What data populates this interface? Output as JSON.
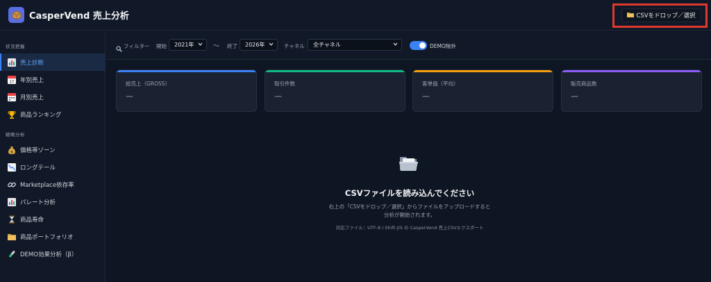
{
  "header": {
    "app_title": "CasperVend 売上分析",
    "csv_button_label": "CSVをドロップ／選択"
  },
  "sidebar": {
    "sections": [
      {
        "label": "状況把握"
      },
      {
        "label": "戦略分析"
      }
    ],
    "items": [
      {
        "label": "売上診断",
        "icon": "bar-chart-icon",
        "active": true
      },
      {
        "label": "年別売上",
        "icon": "calendar-icon"
      },
      {
        "label": "月別売上",
        "icon": "calendar-icon"
      },
      {
        "label": "商品ランキング",
        "icon": "trophy-icon"
      },
      {
        "label": "価格帯ゾーン",
        "icon": "money-bag-icon"
      },
      {
        "label": "ロングテール",
        "icon": "trend-down-icon"
      },
      {
        "label": "Marketplace依存率",
        "icon": "link-icon"
      },
      {
        "label": "パレート分析",
        "icon": "bar-chart-icon"
      },
      {
        "label": "商品寿命",
        "icon": "hourglass-icon"
      },
      {
        "label": "商品ポートフォリオ",
        "icon": "folder-icon"
      },
      {
        "label": "DEMO効果分析（β）",
        "icon": "test-tube-icon"
      }
    ]
  },
  "filters": {
    "filter_label": "フィルター",
    "start_label": "開始",
    "start_value": "2021年",
    "range_sep": "〜",
    "end_label": "終了",
    "end_value": "2026年",
    "channel_label": "チャネル",
    "channel_value": "全チャネル",
    "demo_toggle_label": "DEMO除外",
    "demo_toggle_on": true
  },
  "kpis": [
    {
      "label": "総売上（GROSS）",
      "value": "—",
      "color": "#3b82f6"
    },
    {
      "label": "取引件数",
      "value": "—",
      "color": "#10b981"
    },
    {
      "label": "客単価（平均）",
      "value": "—",
      "color": "#f59e0b"
    },
    {
      "label": "販売商品数",
      "value": "—",
      "color": "#8b5cf6"
    }
  ],
  "empty_state": {
    "icon": "open-folder-icon",
    "title": "CSVファイルを読み込んでください",
    "desc_line1": "右上の「CSVをドロップ／選択」からファイルをアップロードすると",
    "desc_line2": "分析が開始されます。",
    "note": "対応ファイル：UTF-8 / Shift-JIS の CasperVend 売上CSVエクスポート"
  }
}
